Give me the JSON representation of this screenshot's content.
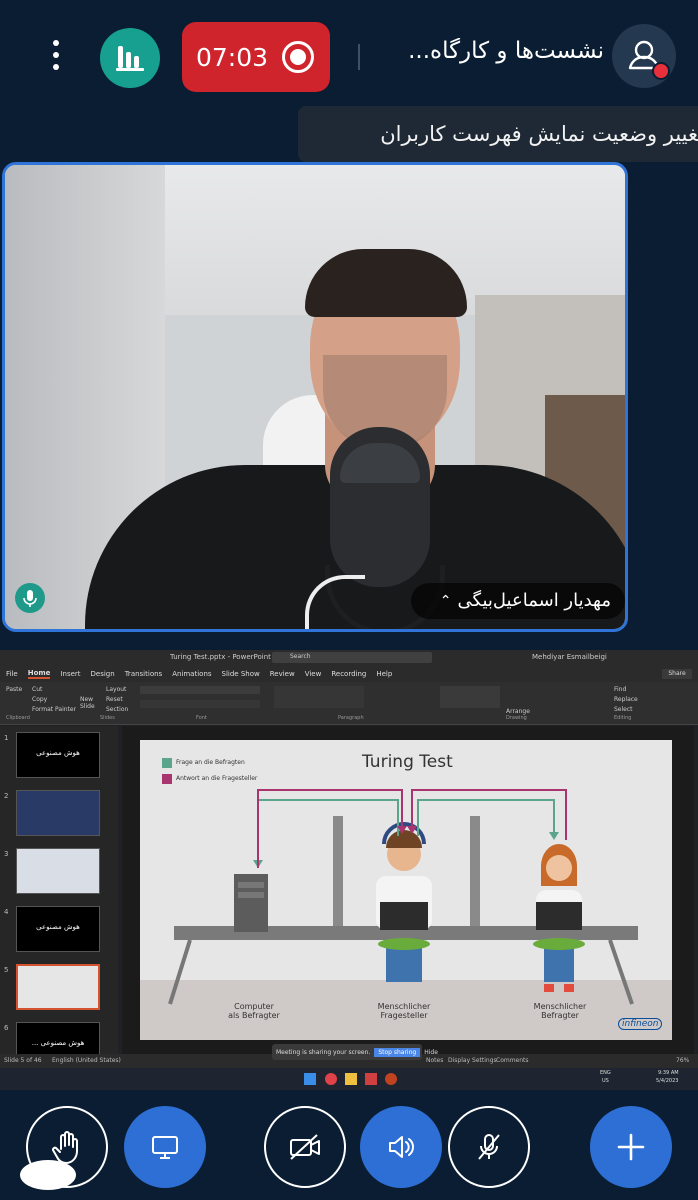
{
  "topbar": {
    "recording_time": "07:03",
    "meeting_title": "نشست‌ها و کارگاه...",
    "tooltip": "تغییر وضعیت نمایش فهرست کاربران",
    "colors": {
      "record": "#d0242c",
      "stats": "#17a08f",
      "accent": "#2f74d8"
    }
  },
  "video": {
    "participant_name": "مهدیار اسماعیل‌بیگی"
  },
  "presentation": {
    "app_title": "Turing Test.pptx - PowerPoint",
    "search_placeholder": "Search",
    "user": "Mehdiyar Esmailbeigi",
    "share_button": "Share",
    "tabs": [
      "File",
      "Home",
      "Insert",
      "Design",
      "Transitions",
      "Animations",
      "Slide Show",
      "Review",
      "View",
      "Recording",
      "Help"
    ],
    "ribbon_groups": [
      "Clipboard",
      "Slides",
      "Font",
      "Paragraph",
      "Drawing",
      "Editing"
    ],
    "ribbon_buttons": {
      "paste": "Paste",
      "cut": "Cut",
      "copy": "Copy",
      "format_painter": "Format Painter",
      "new_slide": "New Slide",
      "layout": "Layout",
      "reset": "Reset",
      "section": "Section",
      "arrange": "Arrange",
      "find": "Find",
      "replace": "Replace",
      "select": "Select"
    },
    "thumbnails": [
      {
        "num": "1",
        "text": "هوش مصنوعی"
      },
      {
        "num": "2",
        "text": ""
      },
      {
        "num": "3",
        "text": ""
      },
      {
        "num": "4",
        "text": "هوش مصنوعی"
      },
      {
        "num": "5",
        "text": ""
      },
      {
        "num": "6",
        "text": "هوش مصنوعی ..."
      }
    ],
    "slide": {
      "title": "Turing Test",
      "legend": [
        {
          "label": "Frage an die Befragten",
          "color": "#5aa58c"
        },
        {
          "label": "Antwort an die Fragesteller",
          "color": "#a8356f"
        }
      ],
      "labels": {
        "left": [
          "Computer",
          "als Befragter"
        ],
        "center": [
          "Menschlicher",
          "Fragesteller"
        ],
        "right": [
          "Menschlicher",
          "Befragter"
        ]
      },
      "logo": "infineon"
    },
    "status": {
      "slide": "Slide 5 of 46",
      "language": "English (United States)",
      "notes": "Notes",
      "display": "Display Settings",
      "comments": "Comments",
      "zoom": "76%"
    },
    "share_banner": {
      "text": "Meeting is sharing your screen.",
      "stop": "Stop sharing",
      "hide": "Hide"
    },
    "taskbar": {
      "lang": "ENG",
      "region": "US",
      "time": "9:39 AM",
      "date": "5/4/2023"
    }
  }
}
